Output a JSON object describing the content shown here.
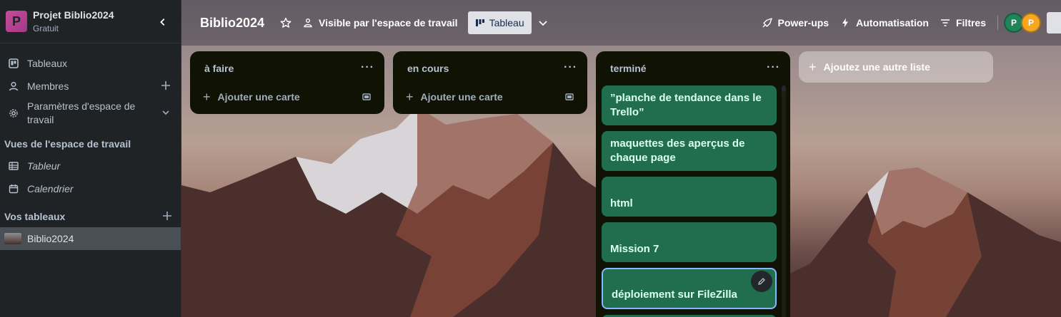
{
  "workspace": {
    "logo_letter": "P",
    "name": "Projet Biblio2024",
    "plan": "Gratuit"
  },
  "sidebar": {
    "items": [
      {
        "label": "Tableaux"
      },
      {
        "label": "Membres"
      },
      {
        "label": "Paramètres d'espace de travail"
      }
    ],
    "views_title": "Vues de l'espace de travail",
    "views": [
      {
        "label": "Tableur"
      },
      {
        "label": "Calendrier"
      }
    ],
    "boards_title": "Vos tableaux",
    "boards": [
      {
        "label": "Biblio2024"
      }
    ]
  },
  "topbar": {
    "board_title": "Biblio2024",
    "visibility": "Visible par l'espace de travail",
    "view": "Tableau",
    "powerups": "Power-ups",
    "automation": "Automatisation",
    "filters": "Filtres",
    "avatars": [
      {
        "letter": "P",
        "color": "#1f845a"
      },
      {
        "letter": "P",
        "color": "#f5a623"
      }
    ]
  },
  "lists": [
    {
      "title": "à faire",
      "add_card": "Ajouter une carte",
      "cards": []
    },
    {
      "title": "en cours",
      "add_card": "Ajouter une carte",
      "cards": []
    },
    {
      "title": "terminé",
      "cards": [
        {
          "text": "”planche de tendance dans le Trello”"
        },
        {
          "text": "maquettes des aperçus de chaque page"
        },
        {
          "text": "html"
        },
        {
          "text": "Mission 7"
        },
        {
          "text": "déploiement sur FileZilla"
        }
      ]
    }
  ],
  "add_list": "Ajoutez une autre liste",
  "colors": {
    "card_green": "#216e4e",
    "list_bg": "#101204",
    "sidebar_bg": "#1f2326"
  }
}
